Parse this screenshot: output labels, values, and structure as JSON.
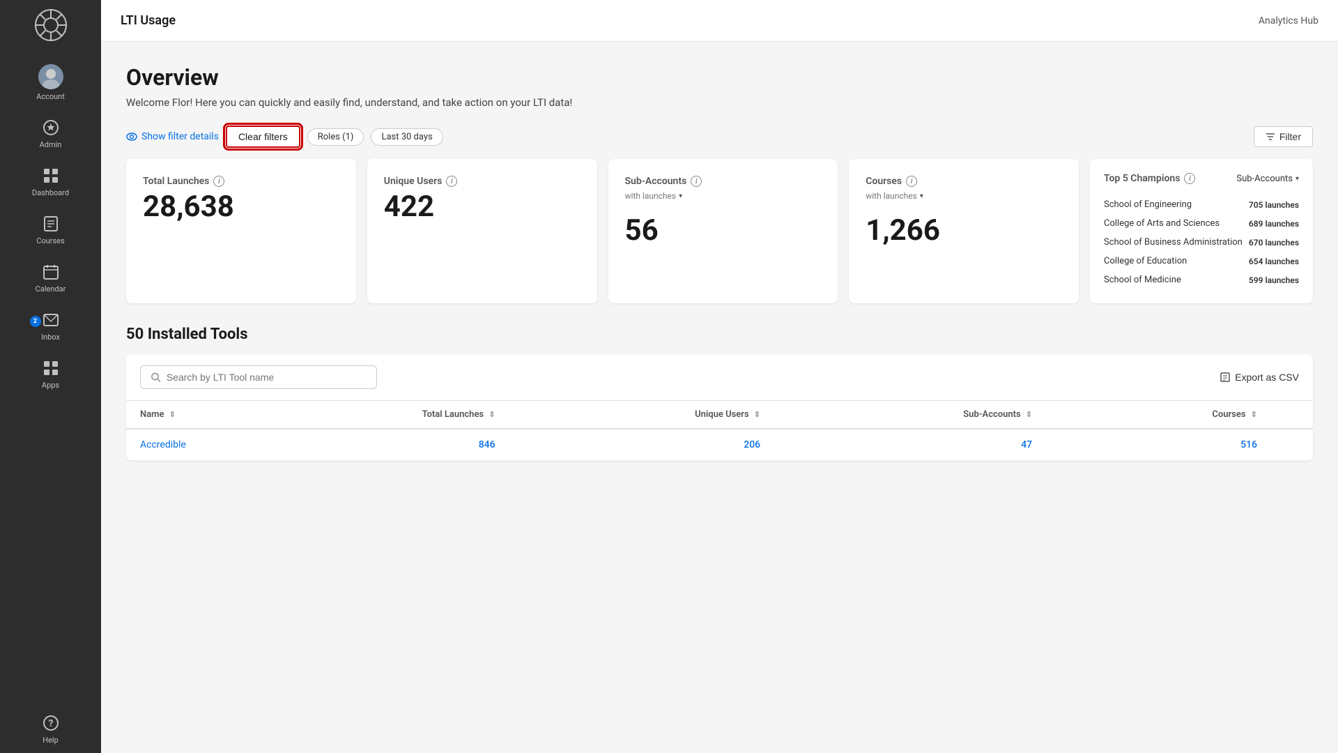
{
  "sidebar": {
    "logo_label": "Canvas Logo",
    "items": [
      {
        "id": "account",
        "label": "Account",
        "icon": "👤",
        "type": "avatar"
      },
      {
        "id": "admin",
        "label": "Admin",
        "icon": "⚙"
      },
      {
        "id": "dashboard",
        "label": "Dashboard",
        "icon": "🏠"
      },
      {
        "id": "courses",
        "label": "Courses",
        "icon": "📋"
      },
      {
        "id": "calendar",
        "label": "Calendar",
        "icon": "📅"
      },
      {
        "id": "inbox",
        "label": "Inbox",
        "icon": "✉",
        "badge": "2"
      },
      {
        "id": "apps",
        "label": "Apps",
        "icon": "⊞"
      },
      {
        "id": "help",
        "label": "Help",
        "icon": "?"
      }
    ]
  },
  "header": {
    "title": "LTI Usage",
    "analytics_hub": "Analytics Hub"
  },
  "overview": {
    "page_title": "Overview",
    "subtitle": "Welcome Flor! Here you can quickly and easily find, understand, and take action on your LTI data!",
    "show_filter_details": "Show filter details",
    "clear_filters": "Clear filters",
    "filter_button": "Filter",
    "tags": [
      {
        "label": "Roles (1)"
      },
      {
        "label": "Last 30 days"
      }
    ]
  },
  "stats": {
    "total_launches": {
      "title": "Total Launches",
      "value": "28,638"
    },
    "unique_users": {
      "title": "Unique Users",
      "value": "422"
    },
    "sub_accounts": {
      "title": "Sub-Accounts",
      "subtitle": "with launches",
      "value": "56"
    },
    "courses": {
      "title": "Courses",
      "subtitle": "with launches",
      "value": "1,266"
    },
    "champions": {
      "title": "Top 5 Champions",
      "dropdown": "Sub-Accounts",
      "rows": [
        {
          "name": "School of Engineering",
          "launches": "705 launches"
        },
        {
          "name": "College of Arts and Sciences",
          "launches": "689 launches"
        },
        {
          "name": "School of Business Administration",
          "launches": "670 launches"
        },
        {
          "name": "College of Education",
          "launches": "654 launches"
        },
        {
          "name": "School of Medicine",
          "launches": "599 launches"
        }
      ]
    }
  },
  "tools_section": {
    "title": "50 Installed Tools",
    "search_placeholder": "Search by LTI Tool name",
    "export_csv": "Export as CSV",
    "columns": [
      {
        "key": "name",
        "label": "Name"
      },
      {
        "key": "total_launches",
        "label": "Total Launches"
      },
      {
        "key": "unique_users",
        "label": "Unique Users"
      },
      {
        "key": "sub_accounts",
        "label": "Sub-Accounts"
      },
      {
        "key": "courses",
        "label": "Courses"
      }
    ],
    "rows": [
      {
        "name": "Accredible",
        "total_launches": "846",
        "unique_users": "206",
        "sub_accounts": "47",
        "courses": "516"
      }
    ]
  }
}
